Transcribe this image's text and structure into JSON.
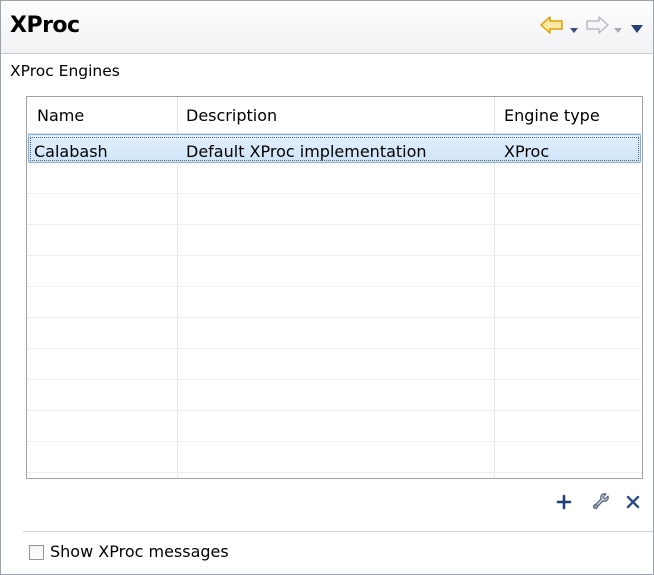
{
  "header": {
    "title": "XProc",
    "nav": {
      "back_icon": "back-arrow-icon",
      "forward_icon": "forward-arrow-icon",
      "menu_icon": "view-menu-icon"
    }
  },
  "section": {
    "label": "XProc Engines"
  },
  "table": {
    "columns": [
      "Name",
      "Description",
      "Engine type"
    ],
    "rows": [
      {
        "name": "Calabash",
        "description": "Default XProc implementation",
        "engine_type": "XProc",
        "selected": true
      }
    ]
  },
  "actions": {
    "add_icon": "plus-icon",
    "edit_icon": "wrench-icon",
    "remove_icon": "delete-x-icon"
  },
  "options": {
    "show_messages_label": "Show XProc messages",
    "show_messages_checked": false
  },
  "colors": {
    "selection_fill": "#d6e8fa",
    "selection_border": "#7fb0e1",
    "nav_active": "#f0b000",
    "accent_blue": "#1a4a9a"
  }
}
